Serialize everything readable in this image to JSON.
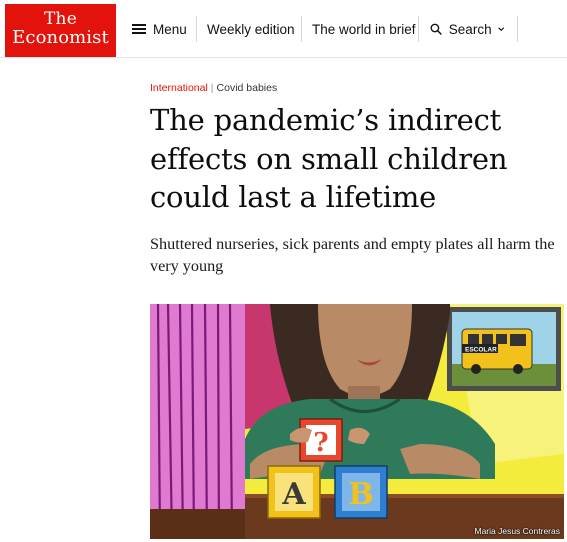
{
  "header": {
    "logo": {
      "line1": "The",
      "line2": "Economist"
    },
    "nav": {
      "menu": "Menu",
      "weekly": "Weekly edition",
      "world": "The world in brief",
      "search": "Search"
    },
    "icons": {
      "menu": "hamburger-icon",
      "search": "search-icon",
      "dropdown": "chevron-down-icon"
    }
  },
  "article": {
    "section": "International",
    "separator": "|",
    "topic": "Covid babies",
    "headline": "The pandemic’s indirect effects on small children could last a lifetime",
    "subheadline": "Shuttered nurseries, sick parents and empty plates all harm the very young"
  },
  "hero": {
    "sign_text": "ESCOLAR",
    "blocks": [
      {
        "letter": "A"
      },
      {
        "letter": "B"
      },
      {
        "letter": "?"
      }
    ],
    "credit": "Maria Jesus Contreras"
  },
  "colors": {
    "brand_red": "#e3120b",
    "text": "#0d0d0d"
  }
}
